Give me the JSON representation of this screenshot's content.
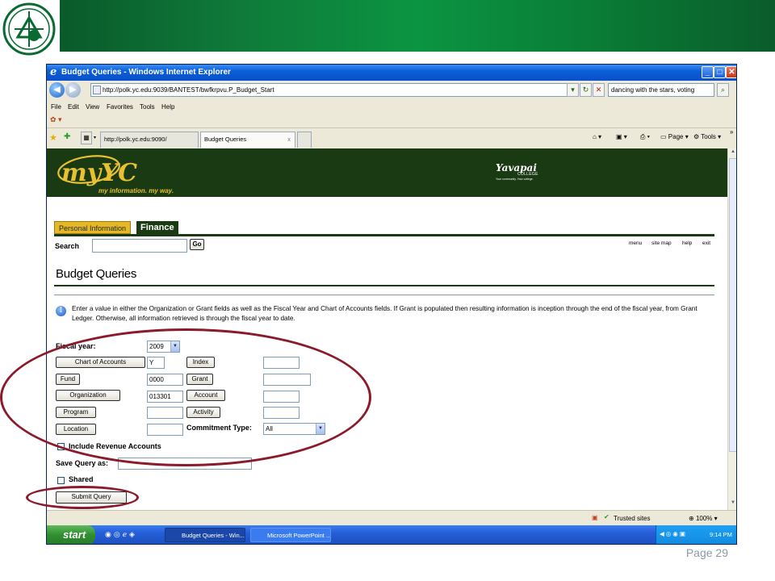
{
  "slide": {
    "page_number": "Page 29",
    "logo_text": "Yavapai College",
    "colors": {
      "header_green": "#0b9442",
      "accent_maroon": "#8b1a2a"
    }
  },
  "window": {
    "title": "Budget Queries - Windows Internet Explorer",
    "address": "http://polk.yc.edu:9039/BANTEST/bwfkrpvu.P_Budget_Start",
    "search_value": "dancing with the stars, voting",
    "menu": [
      "File",
      "Edit",
      "View",
      "Favorites",
      "Tools",
      "Help"
    ],
    "tabs": [
      "http://polk.yc.edu:9090/",
      "Budget Queries"
    ],
    "toolbar": {
      "page": "Page",
      "tools": "Tools"
    }
  },
  "banner": {
    "brand": "myYC",
    "tagline": "my information. my way.",
    "college_name": "Yavapai",
    "college_word": "COLLEGE",
    "college_motto": "Your community. Your college."
  },
  "nav_tabs": [
    "Personal Information",
    "Finance"
  ],
  "search": {
    "label": "Search",
    "go": "Go"
  },
  "top_links": [
    "menu",
    "site map",
    "help",
    "exit"
  ],
  "page_title": "Budget Queries",
  "info": "Enter a value in either the Organization or Grant fields as well as the Fiscal Year and Chart of Accounts fields. If Grant is populated then resulting information is inception through the end of the fiscal year, from Grant Ledger. Otherwise, all information retrieved is through the fiscal year to date.",
  "form": {
    "fiscal_year_label": "Fiscal year:",
    "fiscal_year_value": "2009",
    "chart_of_accounts": {
      "label": "Chart of Accounts",
      "value": "Y"
    },
    "fund": {
      "label": "Fund",
      "value": "0000"
    },
    "organization": {
      "label": "Organization",
      "value": "013301"
    },
    "program": {
      "label": "Program",
      "value": ""
    },
    "location": {
      "label": "Location",
      "value": ""
    },
    "index": {
      "label": "Index",
      "value": ""
    },
    "grant": {
      "label": "Grant",
      "value": ""
    },
    "account": {
      "label": "Account",
      "value": ""
    },
    "activity": {
      "label": "Activity",
      "value": ""
    },
    "commitment_type_label": "Commitment Type:",
    "commitment_type_value": "All",
    "include_revenue_label": "Include Revenue Accounts",
    "save_query_label": "Save Query as:",
    "shared_label": "Shared",
    "submit_label": "Submit Query"
  },
  "status": {
    "zone": "Trusted sites",
    "zoom": "100%"
  },
  "taskbar": {
    "start": "start",
    "items": [
      "Budget Queries - Win...",
      "Microsoft PowerPoint ..."
    ],
    "clock": "9:14 PM"
  }
}
